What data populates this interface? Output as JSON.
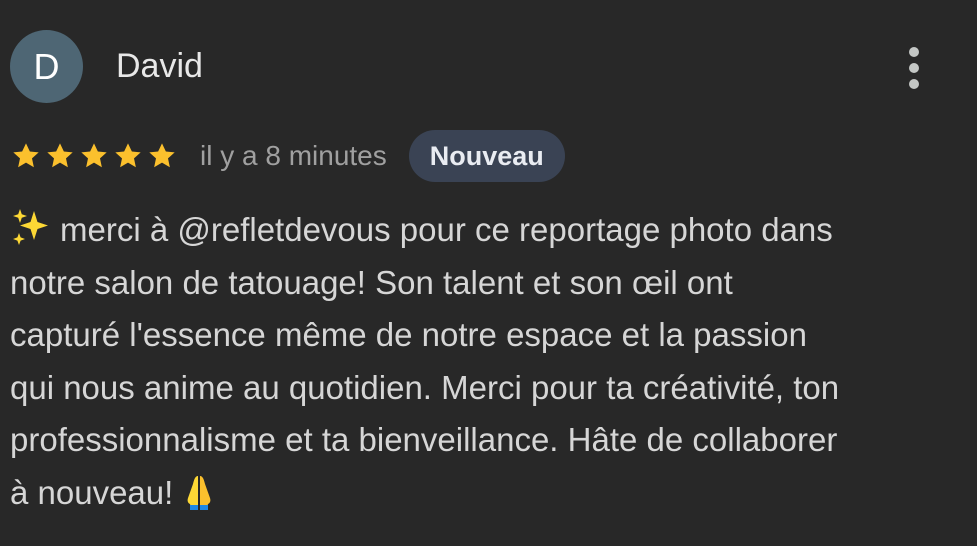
{
  "review": {
    "avatar_initial": "D",
    "author_name": "David",
    "rating": 5,
    "rating_max": 5,
    "time_ago": "il y a 8 minutes",
    "badge": "Nouveau",
    "text": "merci à @refletdevous pour ce reportage photo dans\nnotre salon de tatouage! Son talent et son œil ont\ncapturé l'essence même de notre espace et la passion\nqui nous anime au quotidien. Merci pour ta créativité, ton\nprofessionnalisme et ta bienveillance. Hâte de collaborer\nà nouveau!",
    "leading_emoji": "sparkles-icon",
    "trailing_emoji": "folded-hands-icon"
  },
  "colors": {
    "background": "#282828",
    "avatar": "#4e6674",
    "star": "#fbc02d",
    "badge_bg": "#3a4354",
    "secondary_text": "#a0a0a0"
  },
  "icons": {
    "menu": "more-vert-icon",
    "rating": "star-icon"
  }
}
